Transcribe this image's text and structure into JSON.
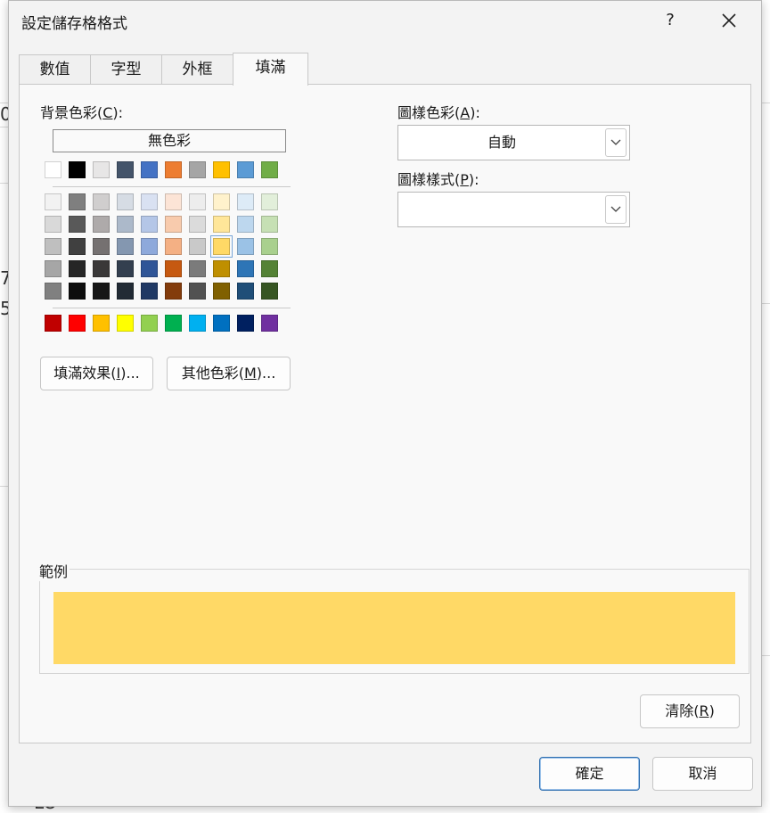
{
  "dialog": {
    "title": "設定儲存格格式",
    "help": "?",
    "close": "✕"
  },
  "tabs": [
    {
      "label": "數值",
      "active": false
    },
    {
      "label": "字型",
      "active": false
    },
    {
      "label": "外框",
      "active": false
    },
    {
      "label": "填滿",
      "active": true
    }
  ],
  "background_color": {
    "label_prefix": "背景色彩(",
    "label_key": "C",
    "label_suffix": "):",
    "no_color": "無色彩",
    "theme_row": [
      "#ffffff",
      "#000000",
      "#e7e6e6",
      "#44546a",
      "#4472c4",
      "#ed7d31",
      "#a5a5a5",
      "#ffc000",
      "#5b9bd5",
      "#70ad47"
    ],
    "shade_rows": [
      [
        "#f2f2f2",
        "#7f7f7f",
        "#d0cece",
        "#d6dce4",
        "#d9e1f2",
        "#fce4d6",
        "#ededed",
        "#fff2cc",
        "#ddebf7",
        "#e2efda"
      ],
      [
        "#d9d9d9",
        "#595959",
        "#aeaaaa",
        "#acb9ca",
        "#b4c6e7",
        "#f8cbad",
        "#dbdbdb",
        "#ffe699",
        "#bdd7ee",
        "#c6e0b4"
      ],
      [
        "#bfbfbf",
        "#404040",
        "#757171",
        "#8497b0",
        "#8ea9db",
        "#f4b084",
        "#c9c9c9",
        "#ffd966",
        "#9bc2e6",
        "#a9d08e"
      ],
      [
        "#a6a6a6",
        "#262626",
        "#3a3838",
        "#333f4f",
        "#2f5597",
        "#c65911",
        "#7b7b7b",
        "#bf8f00",
        "#2e75b6",
        "#548235"
      ],
      [
        "#808080",
        "#0d0d0d",
        "#161616",
        "#222b35",
        "#1f3864",
        "#833c0c",
        "#525252",
        "#806000",
        "#1f4e78",
        "#375623"
      ]
    ],
    "standard_row": [
      "#c00000",
      "#ff0000",
      "#ffc000",
      "#ffff00",
      "#92d050",
      "#00b050",
      "#00b0f0",
      "#0070c0",
      "#002060",
      "#7030a0"
    ],
    "selected": "#ffd966"
  },
  "fill_effects_button": {
    "prefix": "填滿效果(",
    "key": "I",
    "suffix": ")..."
  },
  "more_colors_button": {
    "prefix": "其他色彩(",
    "key": "M",
    "suffix": ")..."
  },
  "pattern_color": {
    "label_prefix": "圖樣色彩(",
    "label_key": "A",
    "label_suffix": "):",
    "value": "自動"
  },
  "pattern_style": {
    "label_prefix": "圖樣樣式(",
    "label_key": "P",
    "label_suffix": "):",
    "value": ""
  },
  "sample": {
    "label": "範例",
    "color": "#ffd966"
  },
  "clear_button": {
    "prefix": "清除(",
    "key": "R",
    "suffix": ")"
  },
  "ok_button": "確定",
  "cancel_button": "取消",
  "background_fragments": [
    "0",
    "7",
    "5",
    "LO"
  ]
}
